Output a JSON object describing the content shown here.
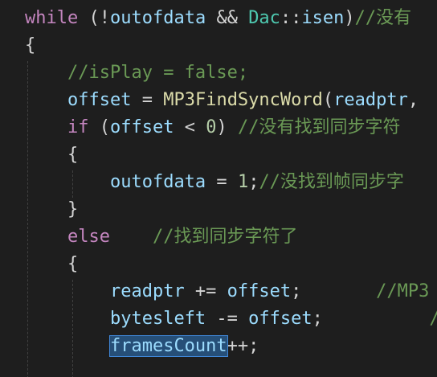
{
  "lines": [
    {
      "tokens": [
        {
          "t": "while",
          "c": "kw"
        },
        {
          "t": " (!",
          "c": "pun"
        },
        {
          "t": "outofdata",
          "c": "var"
        },
        {
          "t": " && ",
          "c": "pun"
        },
        {
          "t": "Dac",
          "c": "type"
        },
        {
          "t": "::",
          "c": "pun"
        },
        {
          "t": "isen",
          "c": "var"
        },
        {
          "t": ")",
          "c": "pun"
        },
        {
          "t": "//没有",
          "c": "cm"
        }
      ]
    },
    {
      "tokens": [
        {
          "t": "{",
          "c": "pun"
        }
      ]
    },
    {
      "tokens": [
        {
          "t": "    ",
          "c": "pun"
        },
        {
          "t": "//isPlay = false;",
          "c": "cm"
        }
      ]
    },
    {
      "tokens": [
        {
          "t": "    ",
          "c": "pun"
        },
        {
          "t": "offset",
          "c": "var"
        },
        {
          "t": " = ",
          "c": "pun"
        },
        {
          "t": "MP3FindSyncWord",
          "c": "fn"
        },
        {
          "t": "(",
          "c": "pun"
        },
        {
          "t": "readptr",
          "c": "var"
        },
        {
          "t": ",",
          "c": "pun"
        }
      ]
    },
    {
      "tokens": [
        {
          "t": "    ",
          "c": "pun"
        },
        {
          "t": "if",
          "c": "kw"
        },
        {
          "t": " (",
          "c": "pun"
        },
        {
          "t": "offset",
          "c": "var"
        },
        {
          "t": " < ",
          "c": "pun"
        },
        {
          "t": "0",
          "c": "num"
        },
        {
          "t": ") ",
          "c": "pun"
        },
        {
          "t": "//没有找到同步字符",
          "c": "cm"
        }
      ]
    },
    {
      "tokens": [
        {
          "t": "    ",
          "c": "pun"
        },
        {
          "t": "{",
          "c": "pun"
        }
      ]
    },
    {
      "tokens": [
        {
          "t": "        ",
          "c": "pun"
        },
        {
          "t": "outofdata",
          "c": "var"
        },
        {
          "t": " = ",
          "c": "pun"
        },
        {
          "t": "1",
          "c": "num"
        },
        {
          "t": ";",
          "c": "pun"
        },
        {
          "t": "//没找到帧同步字",
          "c": "cm"
        }
      ]
    },
    {
      "tokens": [
        {
          "t": "    ",
          "c": "pun"
        },
        {
          "t": "}",
          "c": "pun"
        }
      ]
    },
    {
      "tokens": [
        {
          "t": "    ",
          "c": "pun"
        },
        {
          "t": "else",
          "c": "kw"
        },
        {
          "t": "    ",
          "c": "pun"
        },
        {
          "t": "//找到同步字符了",
          "c": "cm"
        }
      ]
    },
    {
      "tokens": [
        {
          "t": "    ",
          "c": "pun"
        },
        {
          "t": "{",
          "c": "pun"
        }
      ]
    },
    {
      "tokens": [
        {
          "t": "        ",
          "c": "pun"
        },
        {
          "t": "readptr",
          "c": "var"
        },
        {
          "t": " += ",
          "c": "pun"
        },
        {
          "t": "offset",
          "c": "var"
        },
        {
          "t": ";",
          "c": "pun"
        },
        {
          "t": "       ",
          "c": "pun"
        },
        {
          "t": "//MP3",
          "c": "cm"
        }
      ]
    },
    {
      "tokens": [
        {
          "t": "        ",
          "c": "pun"
        },
        {
          "t": "bytesleft",
          "c": "var"
        },
        {
          "t": " -= ",
          "c": "pun"
        },
        {
          "t": "offset",
          "c": "var"
        },
        {
          "t": ";",
          "c": "pun"
        },
        {
          "t": "          ",
          "c": "pun"
        },
        {
          "t": "/",
          "c": "cm"
        }
      ]
    },
    {
      "tokens": [
        {
          "t": "        ",
          "c": "pun"
        },
        {
          "t": "framesCount",
          "c": "sel"
        },
        {
          "t": "++;",
          "c": "pun"
        }
      ]
    }
  ]
}
